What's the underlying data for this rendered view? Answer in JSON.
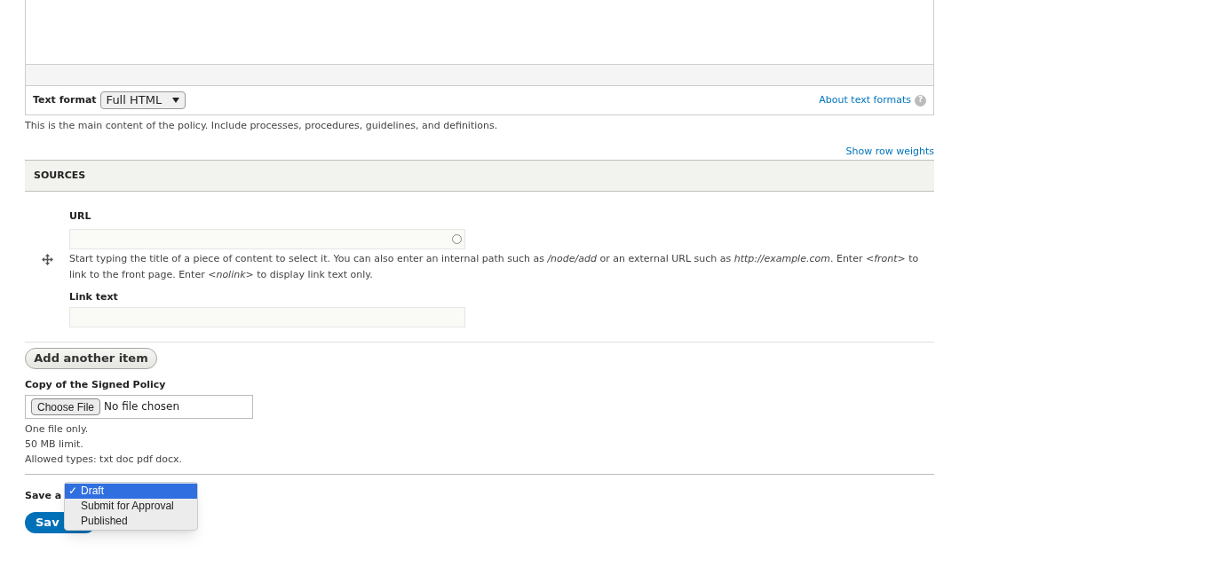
{
  "editor": {
    "text_format_label": "Text format",
    "text_format_value": "Full HTML",
    "about_link": "About text formats",
    "help_glyph": "?",
    "description": "This is the main content of the policy. Include processes, procedures, guidelines, and definitions."
  },
  "sources": {
    "show_weights_link": "Show row weights",
    "heading": "SOURCES",
    "url_label": "URL",
    "url_help": "Start typing the title of a piece of content to select it. You can also enter an internal path such as */node/add* or an external URL such as *http://example.com*. Enter *<front>* to link to the front page. Enter *<nolink>* to display link text only.",
    "link_text_label": "Link text",
    "add_button": "Add another item"
  },
  "file": {
    "label": "Copy of the Signed Policy",
    "choose_button": "Choose File",
    "status": "No file chosen",
    "notes": [
      "One file only.",
      "50 MB limit.",
      "Allowed types: txt doc pdf docx."
    ]
  },
  "save_as": {
    "label": "Save a",
    "check_mark": "✓",
    "options": [
      {
        "label": "Draft",
        "selected": true
      },
      {
        "label": "Submit for Approval",
        "selected": false
      },
      {
        "label": "Published",
        "selected": false
      }
    ]
  },
  "save_button": "Sav"
}
